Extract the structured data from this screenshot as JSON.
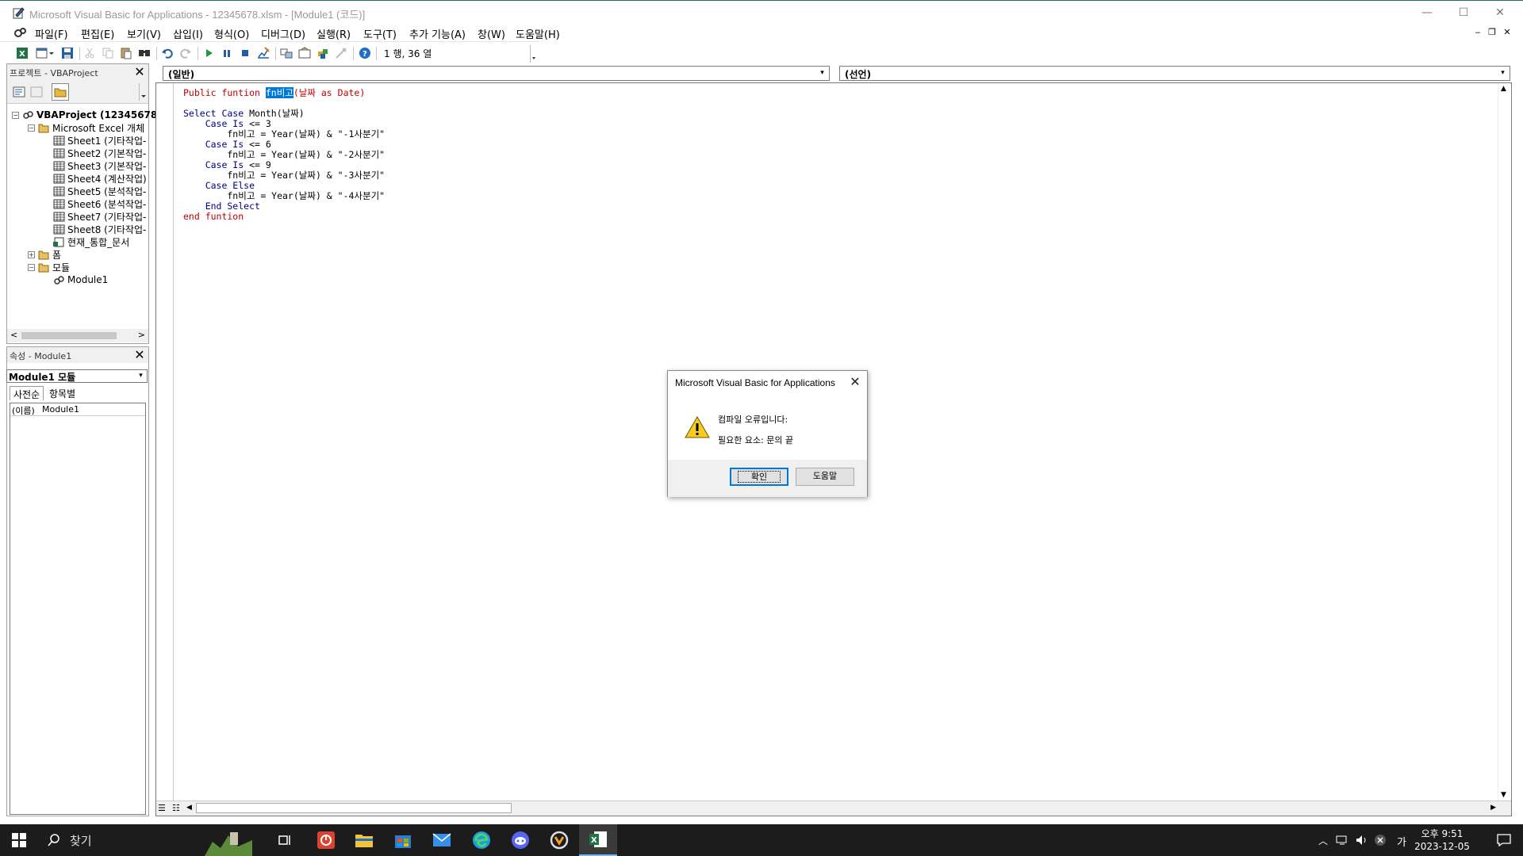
{
  "window": {
    "title": "Microsoft Visual Basic for Applications - 12345678.xlsm - [Module1 (코드)]",
    "minimize": "—",
    "maximize": "☐",
    "close": "✕"
  },
  "menu": {
    "items": [
      "파일(F)",
      "편집(E)",
      "보기(V)",
      "삽입(I)",
      "형식(O)",
      "디버그(D)",
      "실행(R)",
      "도구(T)",
      "추가 기능(A)",
      "창(W)",
      "도움말(H)"
    ],
    "mdi_minimize": "‒",
    "mdi_restore": "❐",
    "mdi_close": "✕"
  },
  "toolbar": {
    "position_label": "1 행, 36 열"
  },
  "project_panel": {
    "title": "프로젝트 - VBAProject",
    "close": "✕",
    "tree": {
      "root": "VBAProject (12345678",
      "excel_objects": "Microsoft Excel 개체",
      "sheets": [
        "Sheet1 (기타작업-",
        "Sheet2 (기본작업-",
        "Sheet3 (기본작업-",
        "Sheet4 (계산작업)",
        "Sheet5 (분석작업-",
        "Sheet6 (분석작업-",
        "Sheet7 (기타작업-",
        "Sheet8 (기타작업-"
      ],
      "workbook": "현재_통합_문서",
      "forms": "폼",
      "modules": "모듈",
      "module1": "Module1"
    },
    "scroll_left": "<",
    "scroll_right": ">"
  },
  "properties_panel": {
    "title": "속성 - Module1",
    "close": "✕",
    "object_combo": "Module1 모듈",
    "tabs": [
      "사전순",
      "항목별"
    ],
    "row": {
      "name": "(이름)",
      "value": "Module1"
    }
  },
  "code_window": {
    "object_combo": "(일반)",
    "procedure_combo": "(선언)",
    "lines": [
      {
        "segments": [
          {
            "t": "Public funtion ",
            "c": "err"
          },
          {
            "t": "fn비고",
            "c": "sel"
          },
          {
            "t": "(날짜 as Date)",
            "c": "err"
          }
        ]
      },
      {
        "segments": []
      },
      {
        "segments": [
          {
            "t": "Select Case ",
            "c": "kw"
          },
          {
            "t": "Month(날짜)",
            "c": "plain"
          }
        ]
      },
      {
        "segments": [
          {
            "t": "    Case Is",
            "c": "kw"
          },
          {
            "t": " <= 3",
            "c": "plain"
          }
        ]
      },
      {
        "segments": [
          {
            "t": "        fn비고 = Year(날짜) & \"-1사분기\"",
            "c": "plain"
          }
        ]
      },
      {
        "segments": [
          {
            "t": "    Case Is",
            "c": "kw"
          },
          {
            "t": " <= 6",
            "c": "plain"
          }
        ]
      },
      {
        "segments": [
          {
            "t": "        fn비고 = Year(날짜) & \"-2사분기\"",
            "c": "plain"
          }
        ]
      },
      {
        "segments": [
          {
            "t": "    Case Is",
            "c": "kw"
          },
          {
            "t": " <= 9",
            "c": "plain"
          }
        ]
      },
      {
        "segments": [
          {
            "t": "        fn비고 = Year(날짜) & \"-3사분기\"",
            "c": "plain"
          }
        ]
      },
      {
        "segments": [
          {
            "t": "    Case Else",
            "c": "kw"
          }
        ]
      },
      {
        "segments": [
          {
            "t": "        fn비고 = Year(날짜) & \"-4사분기\"",
            "c": "plain"
          }
        ]
      },
      {
        "segments": [
          {
            "t": "    End Select",
            "c": "kw"
          }
        ]
      },
      {
        "segments": [
          {
            "t": "end funtion",
            "c": "err"
          }
        ]
      }
    ]
  },
  "dialog": {
    "title": "Microsoft Visual Basic for Applications",
    "close": "✕",
    "message": "컴파일 오류입니다:",
    "detail": "필요한 요소: 문의 끝",
    "ok_label": "확인",
    "help_label": "도움말"
  },
  "taskbar": {
    "search_label": "찾기",
    "clock_time": "오후 9:51",
    "clock_date": "2023-12-05",
    "ime": "가"
  },
  "colors": {
    "keyword": "#00008b",
    "error": "#c00000",
    "selection": "#0078d7",
    "excel_green": "#217346"
  }
}
